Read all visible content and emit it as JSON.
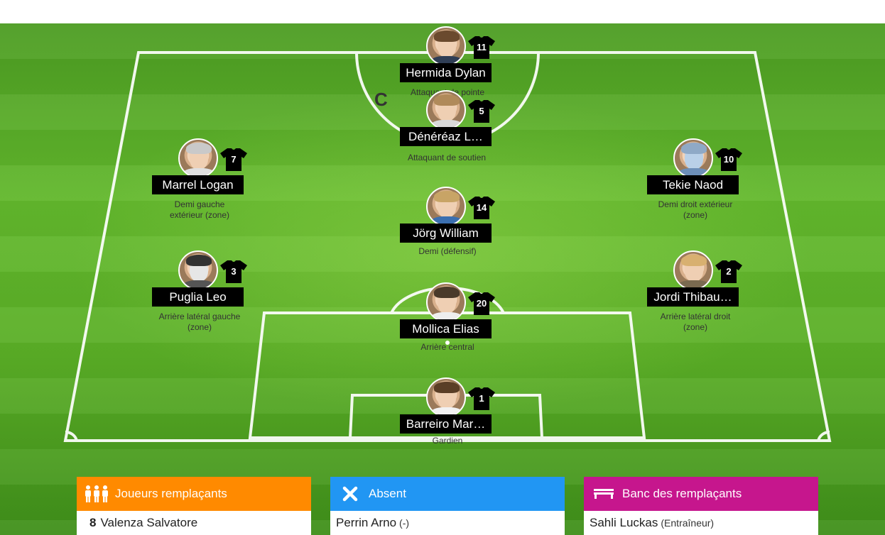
{
  "players": [
    {
      "name": "Hermida Dylan",
      "number": "11",
      "role": "Attaquant de pointe",
      "captain": ""
    },
    {
      "name": "Dénéréaz L…",
      "number": "5",
      "role": "Attaquant de soutien",
      "captain": "C"
    },
    {
      "name": "Marrel Logan",
      "number": "7",
      "role": "Demi gauche extérieur (zone)",
      "captain": ""
    },
    {
      "name": "Tekie Naod",
      "number": "10",
      "role": "Demi droit extérieur (zone)",
      "captain": ""
    },
    {
      "name": "Jörg William",
      "number": "14",
      "role": "Demi (défensif)",
      "captain": ""
    },
    {
      "name": "Puglia Leo",
      "number": "3",
      "role": "Arrière latéral gauche (zone)",
      "captain": ""
    },
    {
      "name": "Jordi Thibau…",
      "number": "2",
      "role": "Arrière latéral droit (zone)",
      "captain": ""
    },
    {
      "name": "Mollica Elias",
      "number": "20",
      "role": "Arrière central",
      "captain": ""
    },
    {
      "name": "Barreiro Mar…",
      "number": "1",
      "role": "Gardien",
      "captain": ""
    }
  ],
  "panels": {
    "substitutes": {
      "title": "Joueurs remplaçants",
      "color": "#ff8a00",
      "icon": "group-icon",
      "item": {
        "number": "8",
        "name": "Valenza Salvatore"
      }
    },
    "absent": {
      "title": "Absent",
      "color": "#2196f3",
      "icon": "close-icon",
      "item": {
        "name": "Perrin Arno",
        "note": "(-)"
      }
    },
    "bench": {
      "title": "Banc des remplaçants",
      "color": "#c6168d",
      "icon": "bench-icon",
      "item": {
        "name": "Sahli Luckas",
        "note": "(Entraîneur)"
      }
    }
  }
}
